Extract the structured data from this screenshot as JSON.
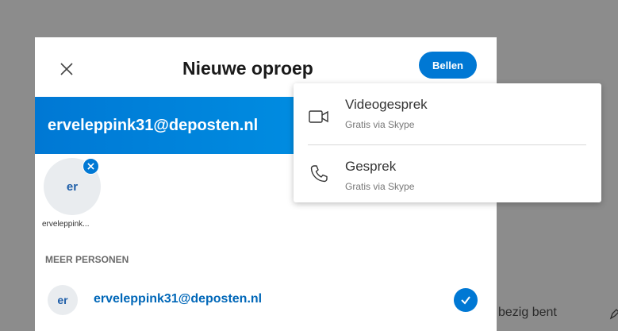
{
  "background": {
    "partial_text": "bezig bent"
  },
  "dialog": {
    "title": "Nieuwe oproep",
    "close_icon": "close-icon",
    "call_button": "Bellen",
    "banner_email": "erveleppink31@deposten.nl",
    "selected_contact": {
      "initials": "er",
      "name_truncated": "erveleppink..."
    },
    "section_label": "MEER PERSONEN",
    "contacts": [
      {
        "initials": "er",
        "email": "erveleppink31@deposten.nl",
        "selected": true
      }
    ]
  },
  "call_menu": {
    "items": [
      {
        "label": "Videogesprek",
        "sublabel": "Gratis via Skype",
        "icon": "video-camera-icon"
      },
      {
        "label": "Gesprek",
        "sublabel": "Gratis via Skype",
        "icon": "phone-icon"
      }
    ]
  },
  "colors": {
    "accent": "#0078d4",
    "overlay": "#8c8c8c",
    "link": "#0067b8"
  }
}
